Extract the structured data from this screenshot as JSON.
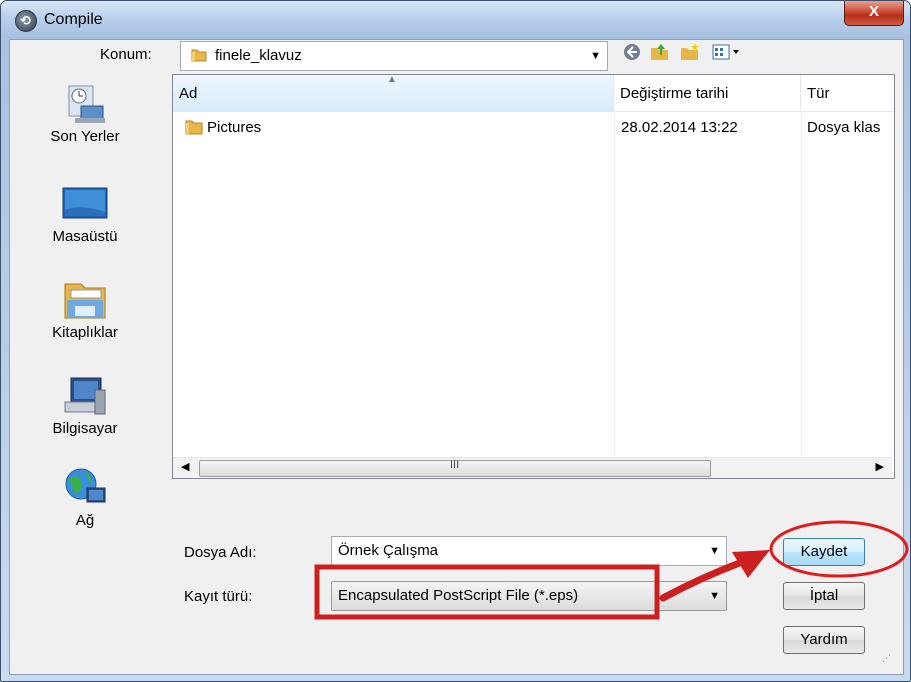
{
  "window": {
    "title": "Compile",
    "close_label": "X"
  },
  "location": {
    "label": "Konum:",
    "value": "finele_klavuz"
  },
  "places": [
    {
      "label": "Son Yerler",
      "icon": "recent-places-icon"
    },
    {
      "label": "Masaüstü",
      "icon": "desktop-icon"
    },
    {
      "label": "Kitaplıklar",
      "icon": "libraries-icon"
    },
    {
      "label": "Bilgisayar",
      "icon": "computer-icon"
    },
    {
      "label": "Ağ",
      "icon": "network-icon"
    }
  ],
  "filelist": {
    "columns": [
      "Ad",
      "Değiştirme tarihi",
      "Tür"
    ],
    "rows": [
      {
        "name": "Pictures",
        "modified": "28.02.2014 13:22",
        "type": "Dosya klas"
      }
    ],
    "scroll_glyph": "III"
  },
  "form": {
    "filename_label": "Dosya Adı:",
    "filename_value": "Örnek Çalışma",
    "filetype_label": "Kayıt türü:",
    "filetype_value": "Encapsulated PostScript File (*.eps)"
  },
  "buttons": {
    "save": "Kaydet",
    "cancel": "İptal",
    "help": "Yardım"
  },
  "colors": {
    "annotation_red": "#cc1f1f",
    "titlebar": "#b8cfea",
    "close_button": "#c8412b"
  }
}
